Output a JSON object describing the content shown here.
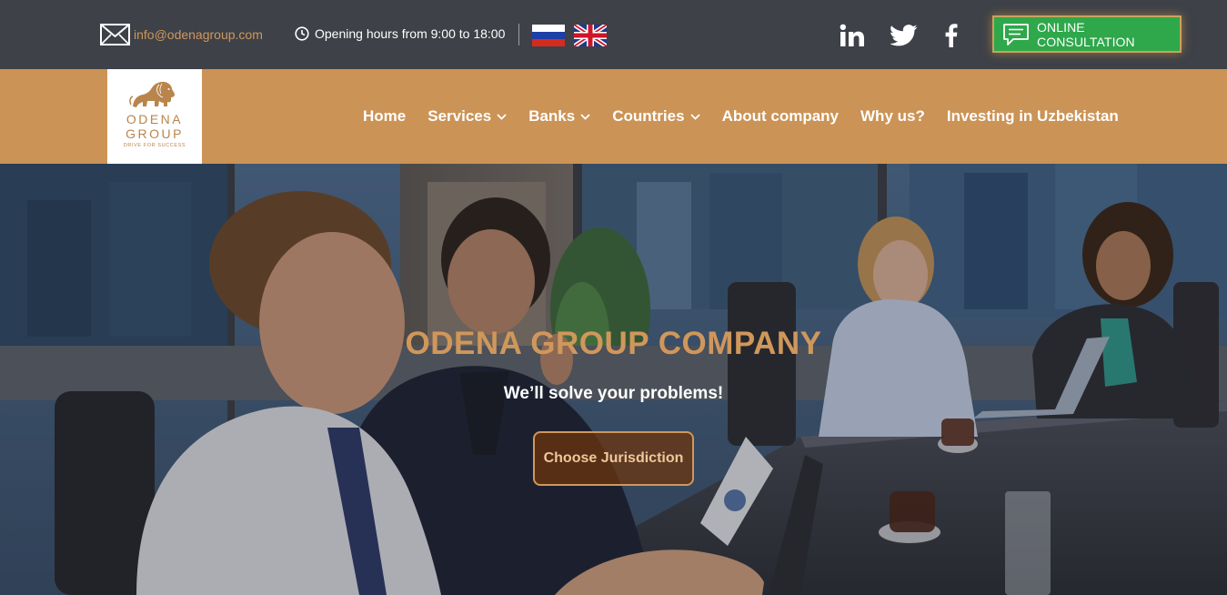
{
  "topbar": {
    "email": "info@odenagroup.com",
    "hours": "Opening hours from 9:00 to 18:00",
    "languages": [
      "russian-flag",
      "english-flag"
    ],
    "social": [
      "linkedin",
      "twitter",
      "facebook"
    ],
    "consult_label": "ONLINE CONSULTATION"
  },
  "logo": {
    "line1": "ODENA",
    "line2": "GROUP",
    "tagline": "DRIVE FOR SUCCESS"
  },
  "nav": {
    "items": [
      {
        "label": "Home",
        "dropdown": false
      },
      {
        "label": "Services",
        "dropdown": true
      },
      {
        "label": "Banks",
        "dropdown": true
      },
      {
        "label": "Countries",
        "dropdown": true
      },
      {
        "label": "About company",
        "dropdown": false
      },
      {
        "label": "Why us?",
        "dropdown": false
      },
      {
        "label": "Investing in Uzbekistan",
        "dropdown": false
      }
    ]
  },
  "hero": {
    "title": "ODENA GROUP COMPANY",
    "subtitle": "We’ll solve your problems!",
    "button": "Choose Jurisdiction"
  },
  "colors": {
    "topbar_bg": "#3e4148",
    "nav_bg": "#cb9356",
    "accent": "#d0975b",
    "consult_green": "#2ea84a"
  }
}
